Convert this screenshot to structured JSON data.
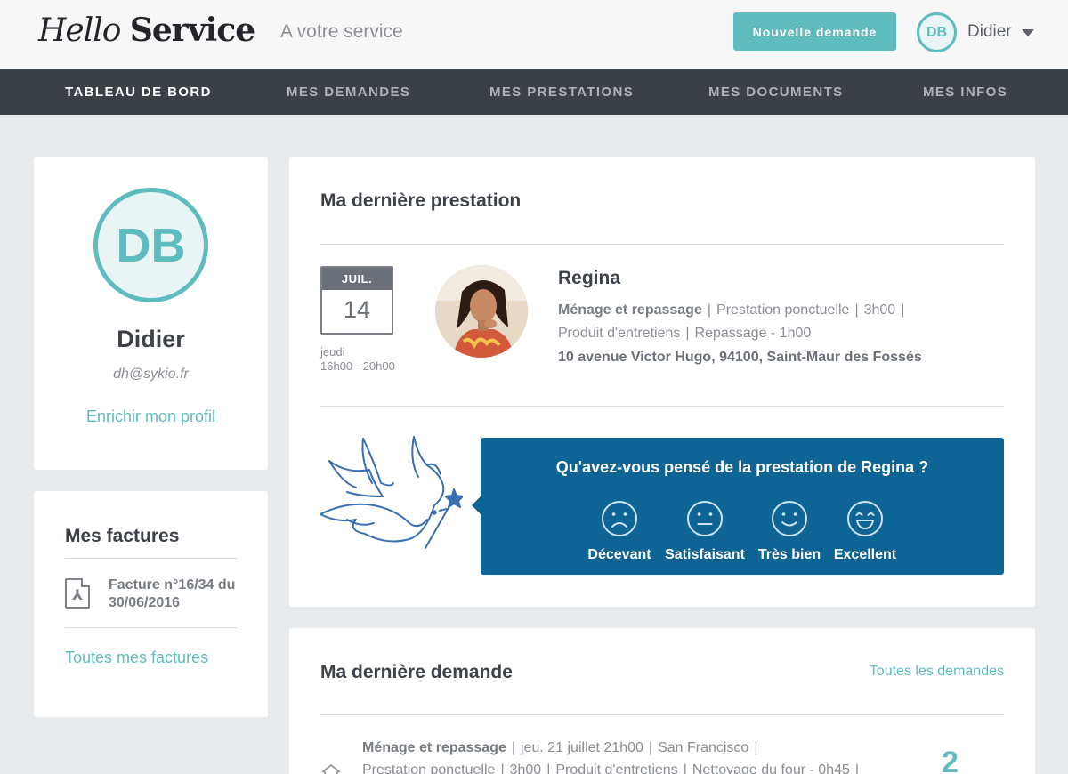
{
  "header": {
    "logo_part1": "Hello",
    "logo_part2": "Service",
    "tagline": "A votre service",
    "new_request_label": "Nouvelle demande",
    "user_initials": "DB",
    "user_name": "Didier"
  },
  "nav": {
    "items": [
      {
        "label": "TABLEAU DE BORD",
        "active": true
      },
      {
        "label": "MES DEMANDES",
        "active": false
      },
      {
        "label": "MES PRESTATIONS",
        "active": false
      },
      {
        "label": "MES DOCUMENTS",
        "active": false
      },
      {
        "label": "MES INFOS",
        "active": false
      }
    ]
  },
  "profile": {
    "initials": "DB",
    "name": "Didier",
    "email": "dh@sykio.fr",
    "enrich_link": "Enrichir mon profil"
  },
  "invoices": {
    "title": "Mes factures",
    "items": [
      {
        "label": "Facture n°16/34 du 30/06/2016"
      }
    ],
    "all_link": "Toutes mes factures"
  },
  "last_service": {
    "title": "Ma dernière prestation",
    "date": {
      "month": "JUIL.",
      "day": "14",
      "weekday": "jeudi",
      "hours": "16h00 - 20h00"
    },
    "worker_name": "Regina",
    "details_line1": {
      "category": "Ménage et repassage",
      "type": "Prestation ponctuelle",
      "duration": "3h00"
    },
    "details_line2": {
      "products": "Produit d'entretiens",
      "extra": "Repassage - 1h00"
    },
    "address": "10 avenue Victor Hugo, 94100, Saint-Maur des Fossés",
    "feedback": {
      "question": "Qu'avez-vous pensé de la prestation de Regina ?",
      "options": [
        {
          "label": "Décevant",
          "icon": "sad-face-icon"
        },
        {
          "label": "Satisfaisant",
          "icon": "neutral-face-icon"
        },
        {
          "label": "Très bien",
          "icon": "smile-face-icon"
        },
        {
          "label": "Excellent",
          "icon": "grin-face-icon"
        }
      ]
    }
  },
  "last_request": {
    "title": "Ma dernière demande",
    "all_link": "Toutes les demandes",
    "line1": {
      "category": "Ménage et repassage",
      "date": "jeu. 21 juillet 21h00",
      "city": "San Francisco"
    },
    "line2": {
      "type": "Prestation ponctuelle",
      "duration": "3h00",
      "products": "Produit d'entretiens",
      "extra": "Nettoyage du four - 0h45"
    },
    "count": "2"
  },
  "colors": {
    "accent": "#5fbcbe",
    "nav_bg": "#3b4047",
    "feedback_bg": "#0f6496"
  }
}
